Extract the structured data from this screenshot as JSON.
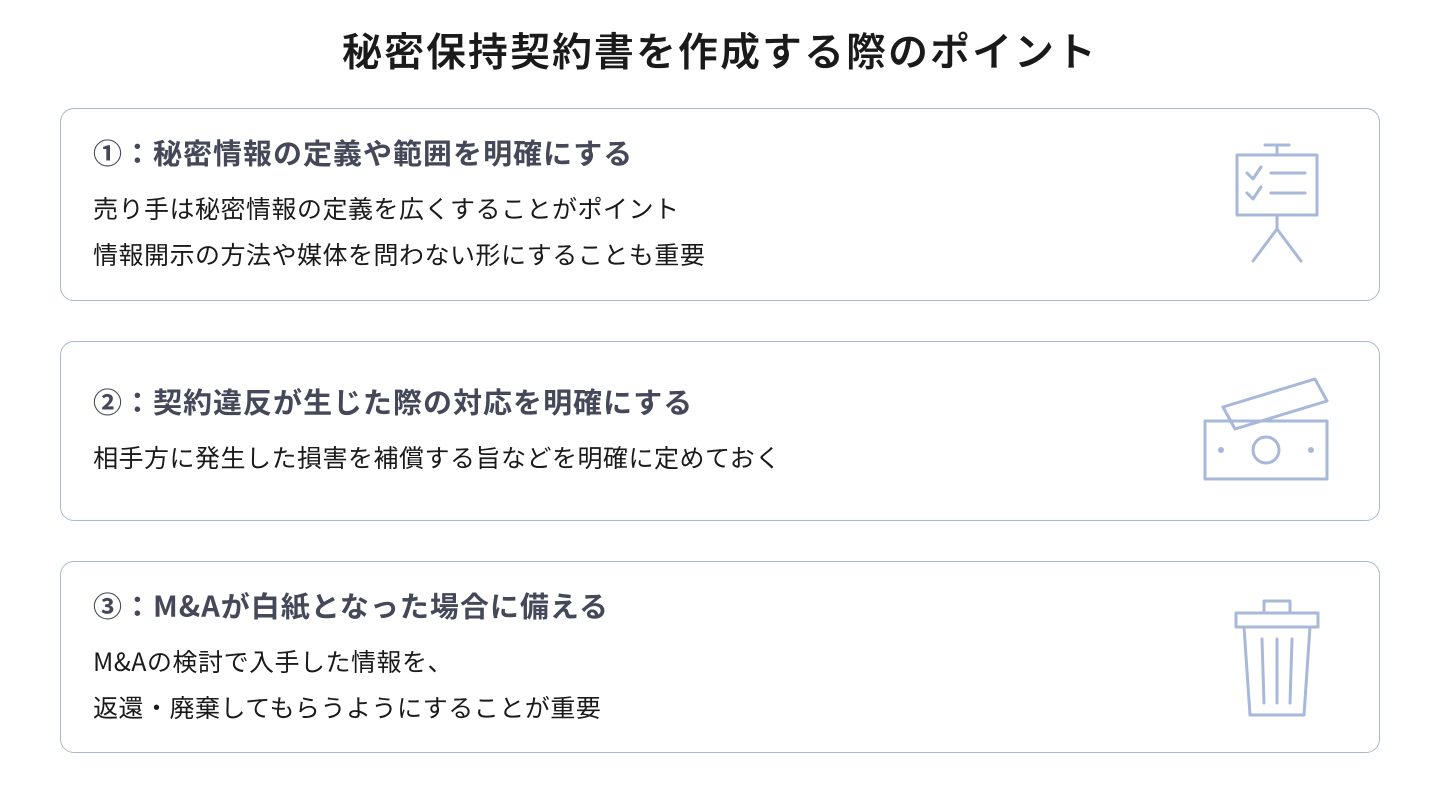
{
  "title": "秘密保持契約書を作成する際のポイント",
  "cards": [
    {
      "heading": "①：秘密情報の定義や範囲を明確にする",
      "line1": "売り手は秘密情報の定義を広くすることがポイント",
      "line2": "情報開示の方法や媒体を問わない形にすることも重要",
      "icon": "presentation-checklist-icon"
    },
    {
      "heading": "②：契約違反が生じた際の対応を明確にする",
      "line1": "相手方に発生した損害を補償する旨などを明確に定めておく",
      "line2": "",
      "icon": "money-icon"
    },
    {
      "heading": "③：M&Aが白紙となった場合に備える",
      "line1": "M&Aの検討で入手した情報を、",
      "line2": "返還・廃棄してもらうようにすることが重要",
      "icon": "trash-icon"
    }
  ]
}
